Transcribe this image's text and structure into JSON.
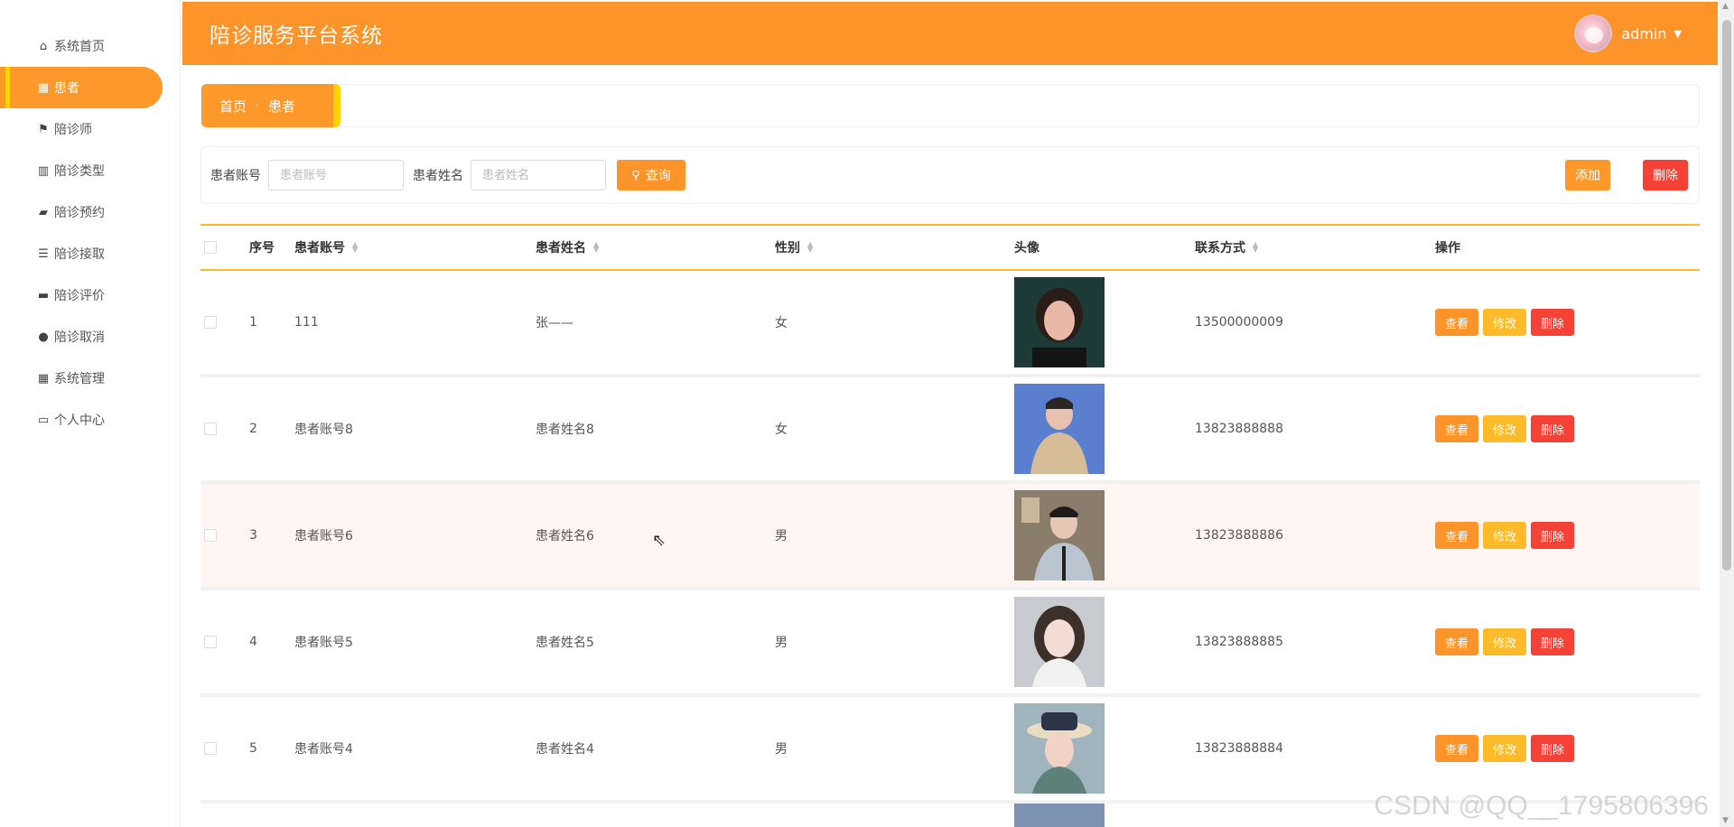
{
  "header": {
    "title": "陪诊服务平台系统",
    "username": "admin"
  },
  "sidebar": {
    "items": [
      {
        "label": "系统首页",
        "icon": "home-icon"
      },
      {
        "label": "患者",
        "icon": "grid-icon"
      },
      {
        "label": "陪诊师",
        "icon": "flag-icon"
      },
      {
        "label": "陪诊类型",
        "icon": "chart-icon"
      },
      {
        "label": "陪诊预约",
        "icon": "wallet-icon"
      },
      {
        "label": "陪诊接取",
        "icon": "list-icon"
      },
      {
        "label": "陪诊评价",
        "icon": "briefcase-icon"
      },
      {
        "label": "陪诊取消",
        "icon": "user-icon"
      },
      {
        "label": "系统管理",
        "icon": "grid-icon"
      },
      {
        "label": "个人中心",
        "icon": "card-icon"
      }
    ]
  },
  "breadcrumb": {
    "home": "首页",
    "separator": "·",
    "current": "患者"
  },
  "search": {
    "account_label": "患者账号",
    "account_placeholder": "患者账号",
    "account_value": "",
    "name_label": "患者姓名",
    "name_placeholder": "患者姓名",
    "name_value": "",
    "search_button": "查询",
    "add_button": "添加",
    "delete_button": "删除"
  },
  "table": {
    "headers": {
      "index": "序号",
      "account": "患者账号",
      "name": "患者姓名",
      "sex": "性别",
      "avatar": "头像",
      "phone": "联系方式",
      "ops": "操作"
    },
    "op_labels": {
      "view": "查看",
      "edit": "修改",
      "delete": "删除"
    },
    "rows": [
      {
        "index": "1",
        "account": "111",
        "name": "张——",
        "sex": "女",
        "phone": "13500000009"
      },
      {
        "index": "2",
        "account": "患者账号8",
        "name": "患者姓名8",
        "sex": "女",
        "phone": "13823888888"
      },
      {
        "index": "3",
        "account": "患者账号6",
        "name": "患者姓名6",
        "sex": "男",
        "phone": "13823888886"
      },
      {
        "index": "4",
        "account": "患者账号5",
        "name": "患者姓名5",
        "sex": "男",
        "phone": "13823888885"
      },
      {
        "index": "5",
        "account": "患者账号4",
        "name": "患者姓名4",
        "sex": "男",
        "phone": "13823888884"
      }
    ]
  },
  "watermark": "CSDN @QQ__1795806396",
  "colors": {
    "accent": "#fd942a",
    "accent_yellow": "#ffd200",
    "danger": "#f44336"
  }
}
